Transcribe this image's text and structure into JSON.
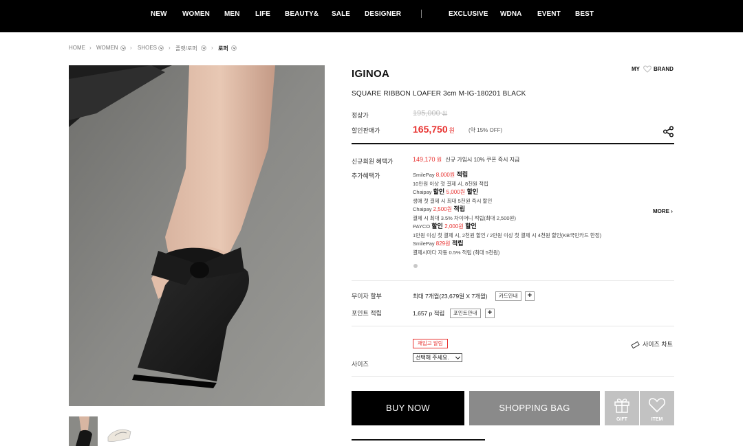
{
  "nav": {
    "items": [
      "NEW",
      "WOMEN",
      "MEN",
      "LIFE",
      "BEAUTY&",
      "SALE",
      "DESIGNER",
      "EXCLUSIVE",
      "WDNA",
      "EVENT",
      "BEST"
    ]
  },
  "breadcrumb": [
    "HOME",
    "WOMEN",
    "SHOES",
    "플랫/로퍼",
    "로퍼"
  ],
  "product": {
    "brand": "IGINOA",
    "name": "SQUARE RIBBON LOAFER 3cm M-IG-180201 BLACK",
    "my_link": "MY",
    "brand_link": "BRAND"
  },
  "price": {
    "regular_label": "정상가",
    "regular_value": "195,000",
    "regular_unit": "원",
    "sale_label": "할인판매가",
    "sale_value": "165,750",
    "sale_unit": "원",
    "discount": "(약 15% OFF)"
  },
  "benefits": {
    "member_label": "신규회원 혜택가",
    "member_price": "149,170",
    "member_unit": "원",
    "member_note": "신규 가입시 10% 쿠폰 즉시 지급",
    "extra_label": "추가혜택가",
    "more": "MORE",
    "lines": [
      {
        "pre": "SmilePay ",
        "red": "8,000원",
        "bold": " 적립"
      },
      {
        "pre": "10만원 이상 첫 결제 시, 8천원 적립",
        "red": "",
        "bold": ""
      },
      {
        "pre": "Chaipay ",
        "red": "5,000원",
        "bold": "할인",
        "boldpre": "할인 ",
        "boldpost": " 할인"
      },
      {
        "pre": "생애 첫 결제 시 최대 5천원 즉시 할인",
        "red": "",
        "bold": ""
      },
      {
        "pre": "Chaipay ",
        "red": "2,500원",
        "bold": " 적립"
      },
      {
        "pre": "결제 시 최대 3.5% 차이머니 적립(최대 2,500원)",
        "red": "",
        "bold": ""
      },
      {
        "pre": "PAYCO ",
        "red": "2,000원",
        "bold": "할인",
        "boldpre": "할인 ",
        "boldpost": " 할인"
      },
      {
        "pre": "1만원 이상 첫 결제 시, 2천원 할인 / 2만원 이상 첫 결제 시 4천원 할인(KB국민카드 한정)",
        "red": "",
        "bold": ""
      },
      {
        "pre": "SmilePay ",
        "red": "829원",
        "bold": " 적립"
      },
      {
        "pre": "결제시마다 자동 0.5% 적립 (최대 5천원)",
        "red": "",
        "bold": ""
      }
    ]
  },
  "installment": {
    "label": "무이자 할부",
    "value": "최대 7개월(23,679원 X 7개월)",
    "card_btn": "카드안내",
    "plus": "+"
  },
  "points": {
    "label": "포인트 적립",
    "value": "1,657 p 적립",
    "btn": "포인트안내",
    "plus": "+"
  },
  "size": {
    "restock": "재입고 알림",
    "chart": "사이즈 차트",
    "label": "사이즈",
    "select": "선택해 주세요."
  },
  "actions": {
    "buy": "BUY NOW",
    "bag": "SHOPPING BAG",
    "gift": "GIFT",
    "item": "ITEM"
  },
  "colors": {
    "accent_red": "#e8312f",
    "nav_bg": "#000000",
    "bag_bg": "#8a8a8a",
    "icon_btn_bg": "#c2c2c2"
  }
}
